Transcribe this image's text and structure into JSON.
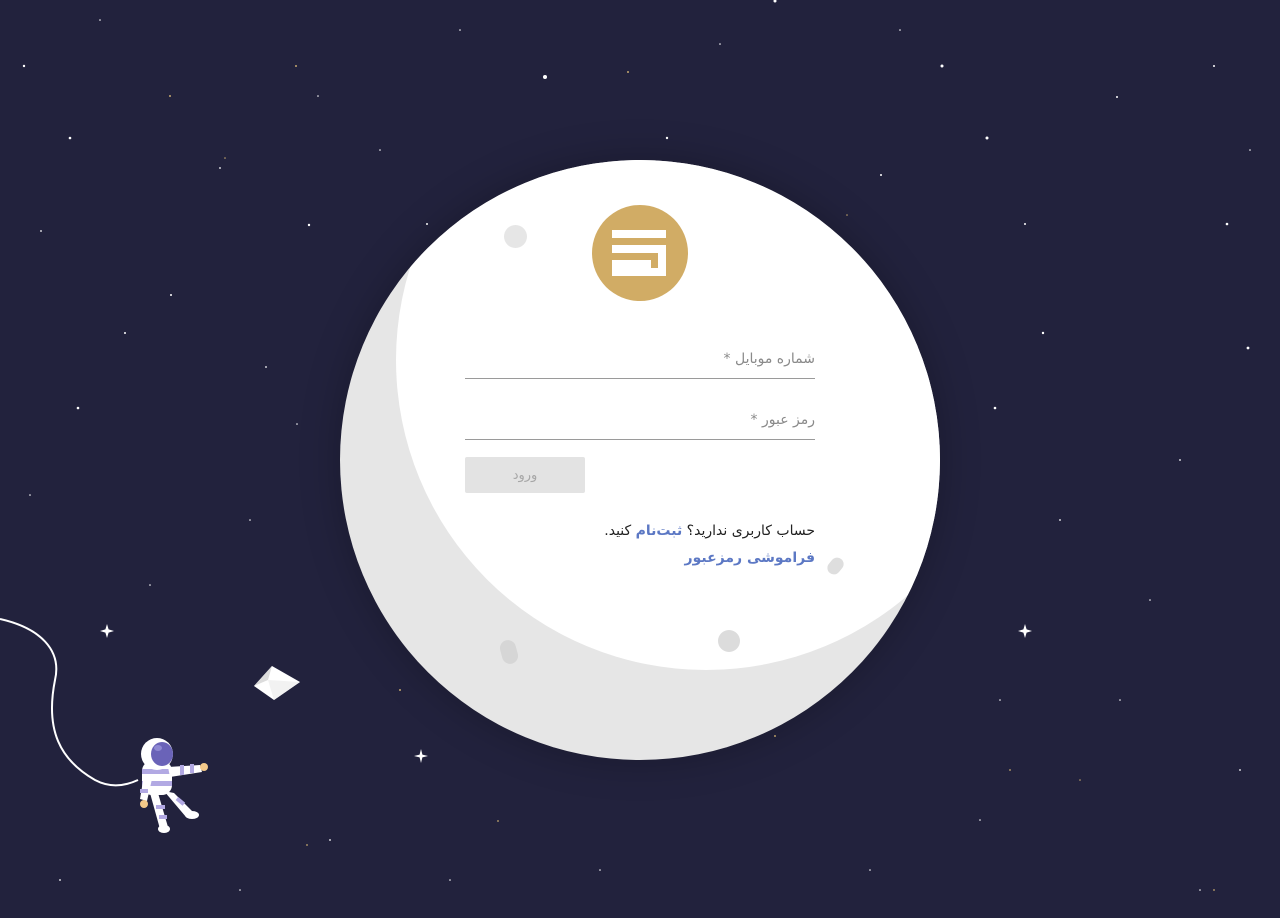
{
  "form": {
    "mobile_label": "شماره موبایل *",
    "password_label": "رمز عبور *",
    "login_label": "ورود",
    "signup_prefix": "حساب کاربری ندارید؟ ",
    "signup_link": "ثبت‌نام",
    "signup_suffix": " کنید.",
    "forgot_link": "فراموشی رمزعبور"
  },
  "colors": {
    "background": "#22223d",
    "moon": "#ffffff",
    "moon_shadow": "#e6e6e6",
    "logo": "#d1ac65",
    "link": "#5c78c4",
    "button_bg": "#e3e3e3"
  },
  "icons": [
    "logo-icon",
    "astronaut-icon",
    "paper-icon",
    "tether-icon"
  ]
}
